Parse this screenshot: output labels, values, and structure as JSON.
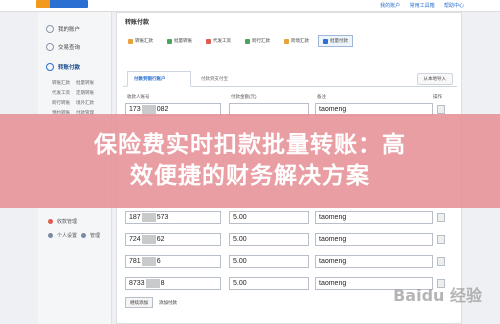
{
  "header": {
    "links": [
      "我的账户",
      "常用工具箱",
      "帮助中心"
    ]
  },
  "sidebar": {
    "items": [
      {
        "label": "我的账户",
        "icon": "user-icon"
      },
      {
        "label": "交易查询",
        "icon": "search-icon"
      },
      {
        "label": "转账付款",
        "icon": "transfer-icon"
      }
    ],
    "sub_items": [
      [
        "转账汇款",
        "批量转账"
      ],
      [
        "代发工资",
        "定期转账"
      ],
      [
        "跨行转账",
        "境外汇款"
      ],
      [
        "预约转账",
        "付款管理"
      ]
    ],
    "bottom_items": [
      [
        "收款管理"
      ],
      [
        "个人设置",
        "管理"
      ]
    ]
  },
  "main": {
    "title": "转账付款",
    "toolbar": [
      "转账汇款",
      "批量转账",
      "代发工资",
      "跨行汇款",
      "跨境汇款",
      "批量付款"
    ],
    "tabs": {
      "active": "付款到银行账户",
      "other": "付款到支付宝"
    },
    "tab_right": "从本地导入",
    "columns": {
      "account": "收款人账号",
      "amount": "付款金额(元)",
      "remark": "备注",
      "action": "操作"
    },
    "rows": [
      {
        "account_prefix": "173",
        "account_suffix": "082",
        "amount": "",
        "remark": "taomeng"
      },
      {
        "account_prefix": "187",
        "account_suffix": "573",
        "amount": "5.00",
        "remark": "taomeng"
      },
      {
        "account_prefix": "724",
        "account_suffix": "62",
        "amount": "5.00",
        "remark": "taomeng"
      },
      {
        "account_prefix": "781",
        "account_suffix": "6",
        "amount": "5.00",
        "remark": "taomeng"
      },
      {
        "account_prefix": "8733",
        "account_suffix": "8",
        "amount": "5.00",
        "remark": "taomeng"
      }
    ],
    "add_row_label": "继续添加",
    "add_row_note": "添加付款"
  },
  "banner": {
    "line1": "保险费实时扣款批量转账：高",
    "line2": "效便捷的财务解决方案"
  },
  "watermark": "Baidu 经验",
  "colors": {
    "banner": "#e69196",
    "accent": "#2a6fd1"
  }
}
